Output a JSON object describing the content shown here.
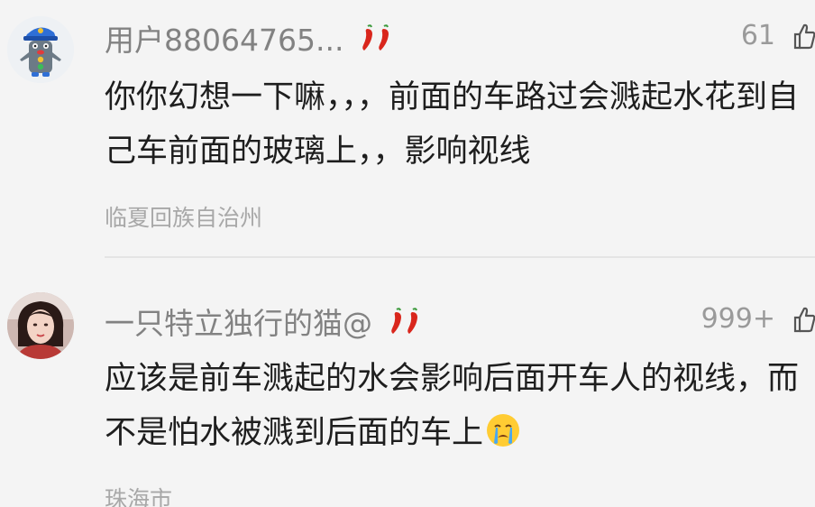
{
  "comments": [
    {
      "username": "用户88064765...",
      "badge_icon": "chili-pepper-icon",
      "likes": "61",
      "text": "你你幻想一下嘛，，，前面的车路过会溅起水花到自己车前面的玻璃上，，影响视线",
      "location": "临夏回族自治州"
    },
    {
      "username": "一只特立独行的猫@",
      "badge_icon": "chili-pepper-icon",
      "likes": "999+",
      "text": "应该是前车溅起的水会影响后面开车人的视线，而不是怕水被溅到后面的车上",
      "emoji": "crying-face-emoji",
      "location": "珠海市"
    }
  ],
  "colors": {
    "username": "#828282",
    "text": "#1e1e1e",
    "meta": "#a8a8a8",
    "background": "#f4f4f4",
    "chili": "#d9261c"
  }
}
